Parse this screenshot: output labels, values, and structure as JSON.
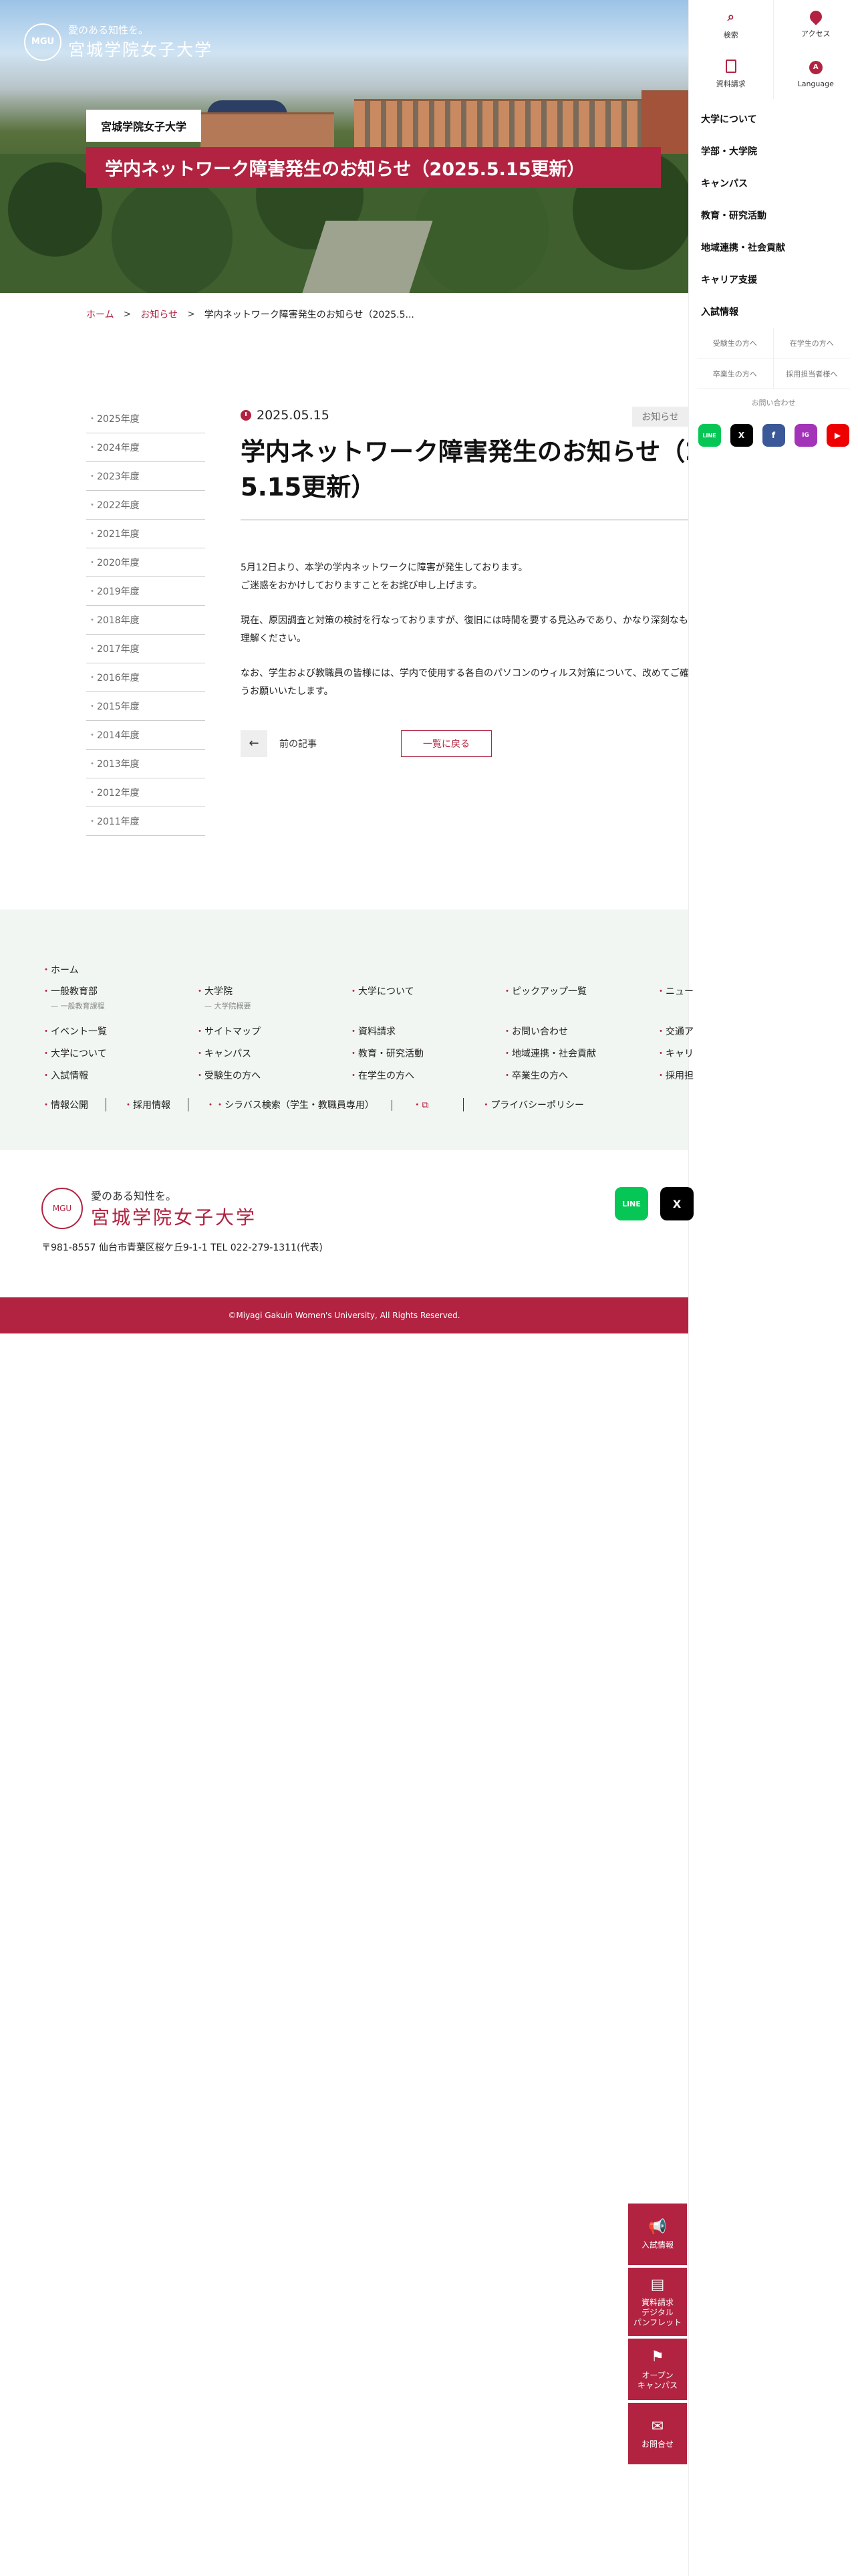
{
  "hero": {
    "brand_tagline": "愛のある知性を。",
    "brand_name": "宮城学院女子大学",
    "seal": "MGU",
    "chip": "宮城学院女子大学",
    "title": "学内ネットワーク障害発生のお知らせ（2025.5.15更新）"
  },
  "nav": {
    "tools": [
      {
        "label": "検索",
        "icon": "search-icon"
      },
      {
        "label": "アクセス",
        "icon": "map-pin-icon"
      },
      {
        "label": "資料請求",
        "icon": "document-icon"
      },
      {
        "label": "Language",
        "icon": "language-icon"
      }
    ],
    "menu": [
      "大学について",
      "学部・大学院",
      "キャンパス",
      "教育・研究活動",
      "地域連携・社会貢献",
      "キャリア支援",
      "入試情報"
    ],
    "sub": [
      "受験生の方へ",
      "在学生の方へ",
      "卒業生の方へ",
      "採用担当者様へ"
    ],
    "contact": "お問い合わせ",
    "social": [
      "LINE",
      "X",
      "f",
      "IG",
      "▶"
    ]
  },
  "breadcrumb": {
    "home": "ホーム",
    "news": "お知らせ",
    "current": "学内ネットワーク障害発生のお知らせ（2025.5..."
  },
  "archive": [
    "2025年度",
    "2024年度",
    "2023年度",
    "2022年度",
    "2021年度",
    "2020年度",
    "2019年度",
    "2018年度",
    "2017年度",
    "2016年度",
    "2015年度",
    "2014年度",
    "2013年度",
    "2012年度",
    "2011年度"
  ],
  "article": {
    "date": "2025.05.15",
    "category": "お知らせ",
    "title_line1": "学内ネットワーク障害発生のお知らせ（2",
    "title_line2": "5.15更新）",
    "p1a": "5月12日より、本学の学内ネットワークに障害が発生しております。",
    "p1b": "ご迷惑をおかけしておりますことをお詫び申し上げます。",
    "p2a": "現在、原因調査と対策の検討を行なっておりますが、復旧には時間を要する見込みであり、かなり深刻なも",
    "p2b": "理解ください。",
    "p3a": "なお、学生および教職員の皆様には、学内で使用する各自のパソコンのウィルス対策について、改めてご確",
    "p3b": "うお願いいたします。",
    "prev": "前の記事",
    "back": "一覧に戻る"
  },
  "footer": {
    "home": "ホーム",
    "row1": [
      {
        "label": "一般教育部",
        "sub": "— 一般教育課程"
      },
      {
        "label": "大学院",
        "sub": "— 大学院概要"
      },
      {
        "label": "大学について",
        "sub": ""
      },
      {
        "label": "ピックアップ一覧",
        "sub": ""
      },
      {
        "label": "ニュー",
        "sub": ""
      }
    ],
    "row2": [
      "イベント一覧",
      "サイトマップ",
      "資料請求",
      "お問い合わせ",
      "交通ア"
    ],
    "row3": [
      "大学について",
      "キャンパス",
      "教育・研究活動",
      "地域連携・社会貢献",
      "キャリ"
    ],
    "row4": [
      "入試情報",
      "受験生の方へ",
      "在学生の方へ",
      "卒業生の方へ",
      "採用担"
    ],
    "bottom": [
      "情報公開",
      "採用情報",
      "シラバス検索（学生・教職員専用）",
      "プライバシーポリシー"
    ],
    "tagline": "愛のある知性を。",
    "name": "宮城学院女子大学",
    "address": "〒981-8557 仙台市青葉区桜ケ丘9-1-1 TEL 022-279-1311(代表)",
    "copyright": "©Miyagi Gakuin Women's University, All Rights Reserved."
  },
  "float": [
    {
      "label": "入試情報",
      "icon": "megaphone-icon"
    },
    {
      "label": "資料請求\nデジタル\nパンフレット",
      "icon": "document-icon"
    },
    {
      "label": "オープン\nキャンパス",
      "icon": "flag-icon"
    },
    {
      "label": "お問合せ",
      "icon": "mail-icon"
    }
  ],
  "colors": {
    "accent": "#b12341",
    "footer_bg": "#f1f6f2"
  }
}
